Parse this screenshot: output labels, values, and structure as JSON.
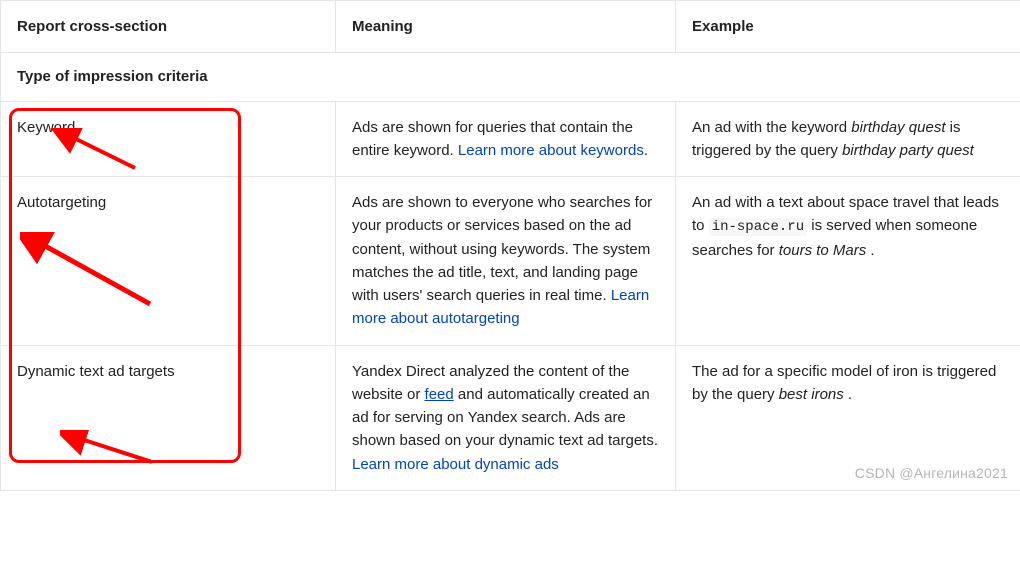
{
  "headers": {
    "col1": "Report cross-section",
    "col2": "Meaning",
    "col3": "Example"
  },
  "section_title": "Type of impression criteria",
  "rows": [
    {
      "name": "Keyword",
      "meaning_pre": "Ads are shown for queries that contain the entire keyword. ",
      "meaning_link": "Learn more about keywords",
      "meaning_post": ".",
      "example_pre": "An ad with the keyword ",
      "example_em1": "birthday quest",
      "example_mid": "  is triggered by the query ",
      "example_em2": "birthday party quest",
      "example_post": ""
    },
    {
      "name": "Autotargeting",
      "meaning_pre": "Ads are shown to everyone who searches for your products or services based on the ad content, without using keywords. The system matches the ad title, text, and landing page with users' search queries in real time. ",
      "meaning_link": "Learn more about autotargeting",
      "meaning_post": "",
      "example_pre": "An ad with a text about space travel that leads to ",
      "example_code": "in-space.ru",
      "example_mid": "  is served when someone searches for ",
      "example_em2": "tours to Mars",
      "example_post": " ."
    },
    {
      "name": "Dynamic text ad targets",
      "meaning_pre": "Yandex Direct analyzed the content of the website or ",
      "meaning_inline_link": "feed",
      "meaning_mid": " and automatically created an ad for serving on Yandex search. Ads are shown based on your dynamic text ad targets. ",
      "meaning_link": "Learn more about dynamic ads",
      "meaning_post": "",
      "example_pre": "The ad for a specific model of iron is triggered by the query ",
      "example_em2": "best irons",
      "example_post": " ."
    }
  ],
  "watermark": "CSDN @Ангелина2021"
}
